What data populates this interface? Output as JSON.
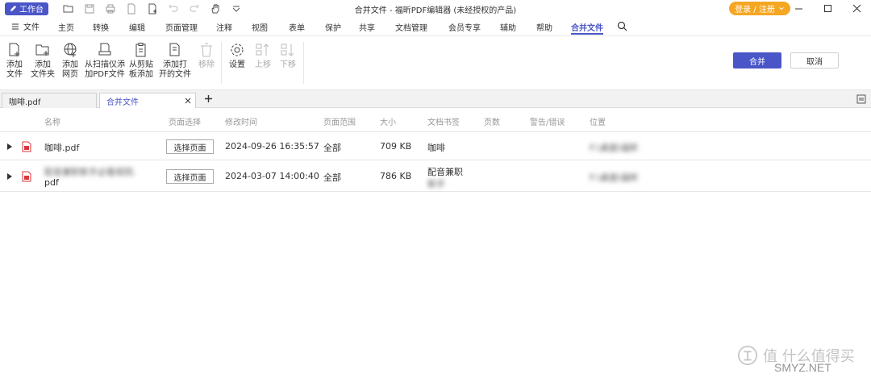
{
  "titlebar": {
    "workbench": "工作台",
    "title": "合并文件 - 福昕PDF编辑器 (未经授权的产品)",
    "login": "登录 / 注册"
  },
  "menu": {
    "file": "文件",
    "items": [
      "主页",
      "转换",
      "编辑",
      "页面管理",
      "注释",
      "视图",
      "表单",
      "保护",
      "共享",
      "文档管理",
      "会员专享",
      "辅助",
      "帮助",
      "合并文件"
    ],
    "active": "合并文件"
  },
  "ribbon": {
    "add_file": [
      "添加",
      "文件"
    ],
    "add_folder": [
      "添加",
      "文件夹"
    ],
    "add_web": [
      "添加",
      "网页"
    ],
    "add_scan": [
      "从扫描仪添",
      "加PDF文件"
    ],
    "add_clipboard": [
      "从剪贴",
      "板添加"
    ],
    "add_open": [
      "添加打",
      "开的文件"
    ],
    "remove": "移除",
    "settings": "设置",
    "move_up": "上移",
    "move_down": "下移",
    "merge": "合并",
    "cancel": "取消"
  },
  "tabs": [
    {
      "label": "咖啡.pdf"
    },
    {
      "label": "合并文件"
    }
  ],
  "table": {
    "headers": [
      "名称",
      "页面选择",
      "修改时间",
      "页面范围",
      "大小",
      "文档书签",
      "页数",
      "警告/错误",
      "位置"
    ],
    "page_select_label": "选择页面",
    "rows": [
      {
        "name": "咖啡.pdf",
        "modified": "2024-09-26 16:35:57",
        "range": "全部",
        "size": "709 KB",
        "bookmark": "咖啡",
        "location": "F:\\桌面\\福昕"
      },
      {
        "name_line1": "配音兼职新手必看规则.",
        "name_line2": "pdf",
        "modified": "2024-03-07 14:00:40",
        "range": "全部",
        "size": "786 KB",
        "bookmark_line1": "配音兼职",
        "bookmark_line2": "新手",
        "location": "F:\\桌面\\福昕"
      }
    ]
  },
  "watermark": {
    "line1": "值 什么值得买",
    "line2": "SMYZ.NET"
  },
  "colors": {
    "accent": "#4a55c7",
    "login": "#f5a623",
    "pdf_red": "#d9363e"
  }
}
